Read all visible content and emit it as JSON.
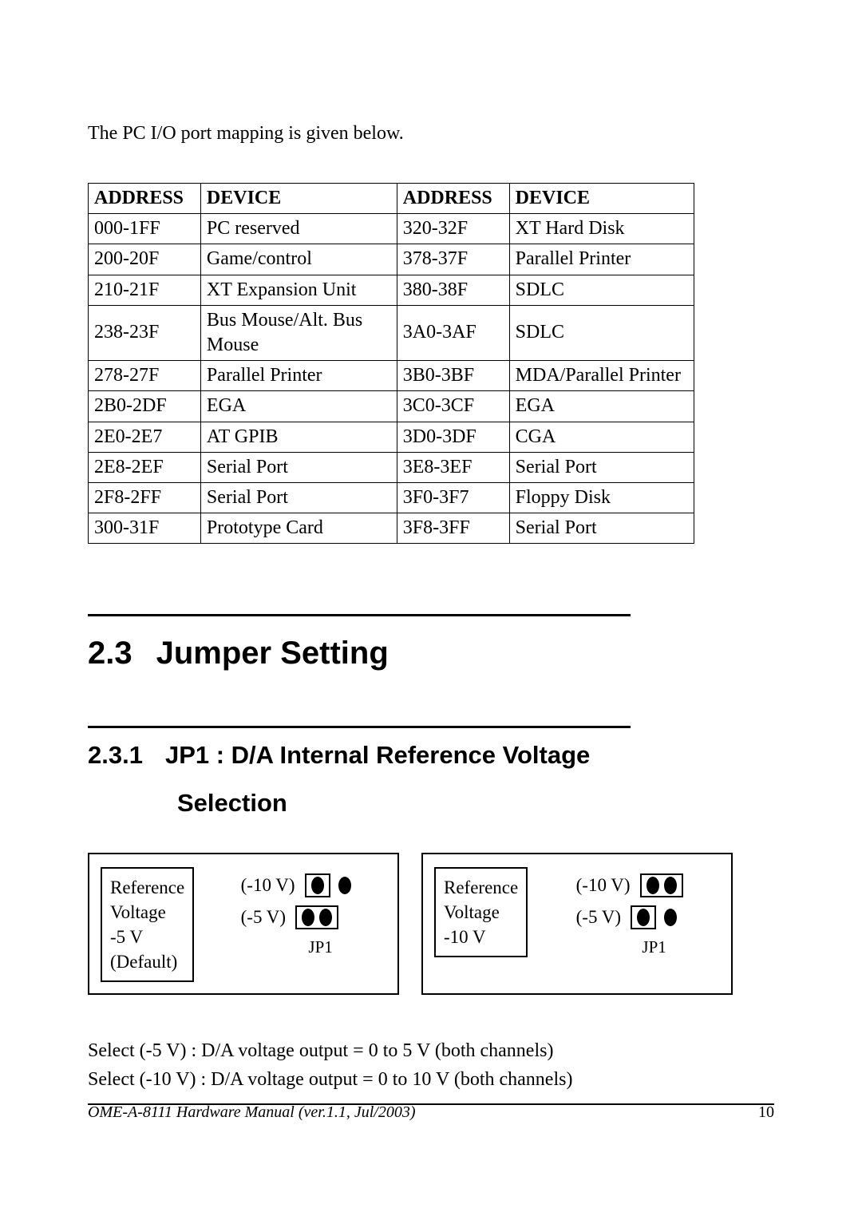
{
  "intro": "The PC I/O port mapping is given below.",
  "table": {
    "headers": [
      "ADDRESS",
      "DEVICE",
      "ADDRESS",
      "DEVICE"
    ],
    "rows": [
      [
        "000-1FF",
        "PC reserved",
        "320-32F",
        "XT Hard Disk"
      ],
      [
        "200-20F",
        "Game/control",
        "378-37F",
        "Parallel Printer"
      ],
      [
        "210-21F",
        "XT Expansion Unit",
        "380-38F",
        "SDLC"
      ],
      [
        "238-23F",
        "Bus Mouse/Alt. Bus Mouse",
        "3A0-3AF",
        "SDLC"
      ],
      [
        "278-27F",
        "Parallel Printer",
        "3B0-3BF",
        "MDA/Parallel Printer"
      ],
      [
        "2B0-2DF",
        "EGA",
        "3C0-3CF",
        "EGA"
      ],
      [
        "2E0-2E7",
        "AT GPIB",
        "3D0-3DF",
        "CGA"
      ],
      [
        "2E8-2EF",
        "Serial Port",
        "3E8-3EF",
        "Serial Port"
      ],
      [
        "2F8-2FF",
        "Serial Port",
        "3F0-3F7",
        "Floppy Disk"
      ],
      [
        "300-31F",
        "Prototype Card",
        "3F8-3FF",
        "Serial Port"
      ]
    ]
  },
  "section": {
    "num": "2.3",
    "title": "Jumper Setting"
  },
  "subsection": {
    "num": "2.3.1",
    "title_line1": "JP1 : D/A Internal Reference Voltage",
    "title_line2": "Selection"
  },
  "diagrams": {
    "left": {
      "ref_text": "Reference\nVoltage\n-5 V\n(Default)",
      "rows": [
        {
          "label": "(-10 V)",
          "closed": false
        },
        {
          "label": "(-5 V)",
          "closed": true
        }
      ],
      "jp": "JP1"
    },
    "right": {
      "ref_text": "Reference\nVoltage\n-10 V",
      "rows": [
        {
          "label": "(-10 V)",
          "closed": true
        },
        {
          "label": "(-5 V)",
          "closed": false
        }
      ],
      "jp": "JP1"
    }
  },
  "explain": {
    "line1": "Select (-5 V)   : D/A voltage output = 0 to 5 V (both channels)",
    "line2": "Select (-10 V) : D/A voltage output = 0 to 10 V (both channels)"
  },
  "footer": {
    "left": "OME-A-8111 Hardware Manual (ver.1.1, Jul/2003)",
    "page": "10"
  }
}
